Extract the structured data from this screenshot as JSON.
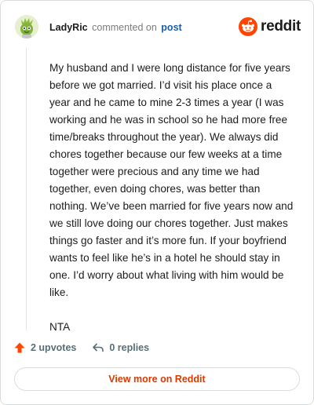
{
  "header": {
    "author": "LadyRic",
    "verb": "commented on",
    "post_link": "post",
    "brand": "reddit"
  },
  "comment": {
    "paragraphs": [
      "My husband and I were long distance for five years before we got married. I’d visit his place once a year and he came to mine 2-3 times a year (I was working and he was in school so he had more free time/breaks throughout the year). We always did chores together because our few weeks at a time together were precious and any time we had together, even doing chores, was better than nothing. We’ve been married for five years now and we still love doing our chores together. Just makes things go faster and it’s more fun. If your boyfriend wants to feel like he’s in a hotel he should stay in one. I’d worry about what living with him would be like.",
      "NTA"
    ]
  },
  "actions": {
    "upvotes": "2 upvotes",
    "replies": "0 replies"
  },
  "footer": {
    "view_more": "View more on Reddit"
  },
  "colors": {
    "brand_orange": "#ff4500",
    "link_blue": "#1a5ea8",
    "cta_orange": "#d93a00"
  },
  "icons": {
    "avatar": "green-character-avatar",
    "brand": "reddit-snoo-icon",
    "upvote": "upvote-arrow-icon",
    "reply": "reply-arrow-icon"
  }
}
